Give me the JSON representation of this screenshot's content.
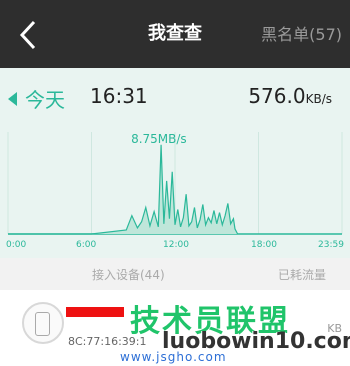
{
  "header": {
    "title": "我查查",
    "blacklist_label": "黑名单(57)"
  },
  "summary": {
    "day_label": "今天",
    "time": "16:31",
    "speed_value": "576.0",
    "speed_unit": "KB/s"
  },
  "chart_data": {
    "type": "area",
    "x_ticks": [
      "0:00",
      "6:00",
      "12:00",
      "18:00",
      "23:59"
    ],
    "peak_label": "8.75MB/s",
    "peak_value": 8.75,
    "y_unit": "MB/s",
    "series": [
      {
        "x": [
          0,
          6,
          8.5,
          8.9,
          9.3,
          9.6,
          9.9,
          10.2,
          10.5,
          10.8,
          11.0,
          11.2,
          11.4,
          11.6,
          11.8,
          12.0,
          12.2,
          12.4,
          12.6,
          12.8,
          13.0,
          13.2,
          13.4,
          13.6,
          13.8,
          14.0,
          14.2,
          14.4,
          14.6,
          14.8,
          15.0,
          15.2,
          15.4,
          15.6,
          15.8,
          16.0,
          16.2,
          16.31,
          16.5
        ],
        "values": [
          0,
          0,
          0.4,
          1.8,
          0.6,
          1.2,
          2.6,
          0.8,
          2.2,
          0.7,
          8.75,
          1.0,
          5.2,
          1.5,
          6.1,
          0.9,
          2.4,
          0.7,
          1.6,
          3.9,
          0.8,
          1.2,
          2.6,
          0.6,
          1.4,
          2.9,
          0.9,
          1.6,
          1.1,
          2.3,
          1.0,
          2.1,
          0.9,
          1.8,
          3.0,
          1.0,
          1.5,
          0.5,
          0
        ]
      }
    ],
    "xlim": [
      0,
      24
    ],
    "ylim": [
      0,
      10
    ],
    "color": "#2bb89a",
    "fill": "#bfe6da"
  },
  "sections": {
    "devices_label": "接入设备(44)",
    "traffic_label": "已耗流量"
  },
  "devices": [
    {
      "mac": "8C:77:16:39:1",
      "traffic": "KB"
    }
  ],
  "watermark": {
    "brand": "技术员联盟",
    "url": "luobowin10.com",
    "url2": "www.jsgho.com"
  },
  "colors": {
    "accent": "#2bb89a",
    "header": "#2e2e2e",
    "redaction": "#ee1111"
  }
}
